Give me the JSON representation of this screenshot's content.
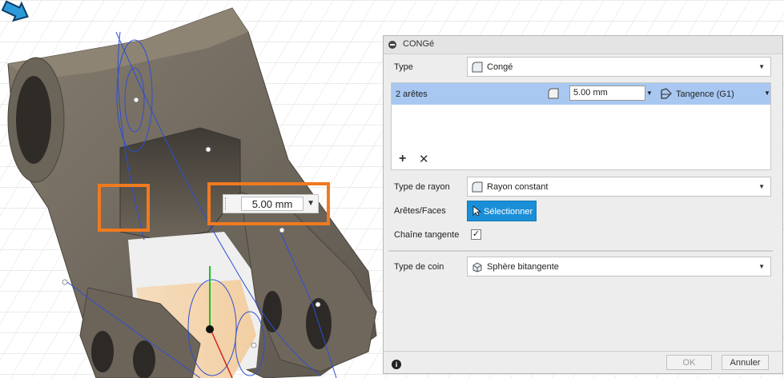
{
  "viewport": {
    "radius_value": "5.00 mm",
    "highlight_color": "#f07a1f"
  },
  "dialog": {
    "title": "CONGé",
    "type": {
      "label": "Type",
      "value": "Congé",
      "icon": "fillet-icon"
    },
    "selection": {
      "row_label": "2 arêtes",
      "radius": "5.00 mm",
      "continuity": "Tangence (G1)"
    },
    "radius_type": {
      "label": "Type de rayon",
      "value": "Rayon constant"
    },
    "edges_faces": {
      "label": "Arêtes/Faces",
      "button": "Sélectionner"
    },
    "tangent_chain": {
      "label": "Chaîne tangente",
      "checked": true
    },
    "corner_type": {
      "label": "Type de coin",
      "value": "Sphère bitangente"
    },
    "ok_label": "OK",
    "cancel_label": "Annuler",
    "accent_color": "#1a8fd8",
    "selected_row_color": "#a8c8f2"
  }
}
